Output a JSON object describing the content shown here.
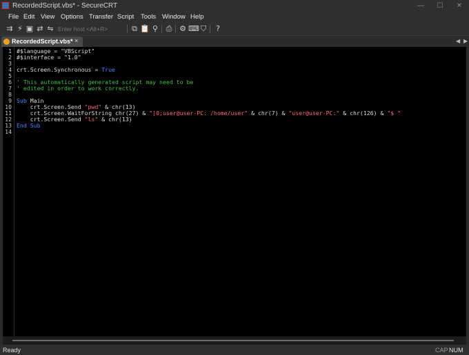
{
  "window": {
    "title": "RecordedScript.vbs* - SecureCRT"
  },
  "menu": [
    "File",
    "Edit",
    "View",
    "Options",
    "Transfer",
    "Script",
    "Tools",
    "Window",
    "Help"
  ],
  "toolbar": {
    "host_placeholder": "Enter host <Alt+R>",
    "icons": [
      "connect-icon",
      "quick-connect-icon",
      "connect-tab-icon",
      "reconnect-icon",
      "disconnect-icon",
      "copy-icon",
      "paste-icon",
      "find-icon",
      "print-icon",
      "settings-icon",
      "keymap-icon",
      "sftp-icon",
      "help-icon"
    ]
  },
  "tab": {
    "label": "RecordedScript.vbs*",
    "close": "×"
  },
  "editor": {
    "line_numbers": [
      "1",
      "2",
      "3",
      "4",
      "5",
      "6",
      "7",
      "8",
      "9",
      "10",
      "11",
      "12",
      "13",
      "14"
    ],
    "lines": [
      [
        {
          "t": "#$language = ",
          "c": ""
        },
        {
          "t": "\"VBScript\"",
          "c": ""
        }
      ],
      [
        {
          "t": "#$interface = ",
          "c": ""
        },
        {
          "t": "\"1.0\"",
          "c": ""
        }
      ],
      [],
      [
        {
          "t": "crt.Screen.Synchronous = ",
          "c": ""
        },
        {
          "t": "True",
          "c": "kw"
        }
      ],
      [],
      [
        {
          "t": "' This automatically generated script may need to be",
          "c": "cmt"
        }
      ],
      [
        {
          "t": "' edited in order to work correctly.",
          "c": "cmt"
        }
      ],
      [],
      [
        {
          "t": "Sub",
          "c": "kw"
        },
        {
          "t": " Main",
          "c": ""
        }
      ],
      [
        {
          "t": "    crt.Screen.Send ",
          "c": ""
        },
        {
          "t": "\"pwd\"",
          "c": "str"
        },
        {
          "t": " & chr(13)",
          "c": ""
        }
      ],
      [
        {
          "t": "    crt.Screen.WaitForString chr(27) & ",
          "c": ""
        },
        {
          "t": "\"]0;user@user-PC: /home/user\"",
          "c": "str"
        },
        {
          "t": " & chr(7) & ",
          "c": ""
        },
        {
          "t": "\"user@user-PC:\"",
          "c": "str"
        },
        {
          "t": " & chr(126) & ",
          "c": ""
        },
        {
          "t": "\"$ \"",
          "c": "str"
        }
      ],
      [
        {
          "t": "    crt.Screen.Send ",
          "c": ""
        },
        {
          "t": "\"ls\"",
          "c": "str"
        },
        {
          "t": " & chr(13)",
          "c": ""
        }
      ],
      [
        {
          "t": "End Sub",
          "c": "kw"
        }
      ],
      []
    ]
  },
  "status": {
    "ready": "Ready",
    "cap": "CAP",
    "num": "NUM"
  },
  "colors": {
    "keyword": "#3d86ff",
    "string": "#ff6b6b",
    "comment": "#3fbf3f",
    "editor_bg": "#000000"
  }
}
